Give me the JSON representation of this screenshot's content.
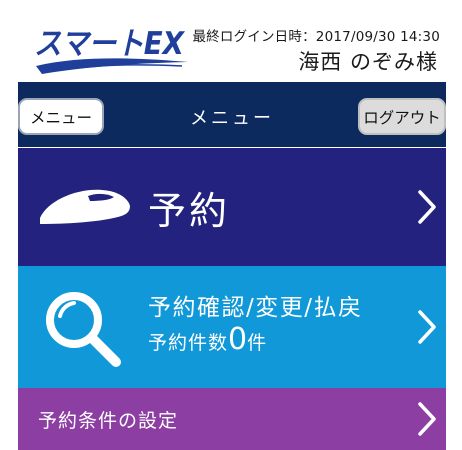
{
  "header": {
    "logo_text": "スマートEX",
    "last_login": "最終ログイン日時：2017/09/30 14:30",
    "user_name": "海西 のぞみ様"
  },
  "nav": {
    "menu_label": "メニュー",
    "title": "メニュー",
    "logout_label": "ログアウト"
  },
  "tiles": {
    "reserve": {
      "label": "予約",
      "icon": "shinkansen-train-icon",
      "color": "#23237f"
    },
    "confirm": {
      "label": "予約確認/変更/払戻",
      "count_prefix": "予約件数",
      "count": "0",
      "count_suffix": "件",
      "icon": "magnifier-icon",
      "color": "#1098d8"
    },
    "settings": {
      "label": "予約条件の設定",
      "color": "#8d3ea3"
    }
  },
  "colors": {
    "brand": "#1f3f9a",
    "navbar": "#0d2a5e"
  }
}
